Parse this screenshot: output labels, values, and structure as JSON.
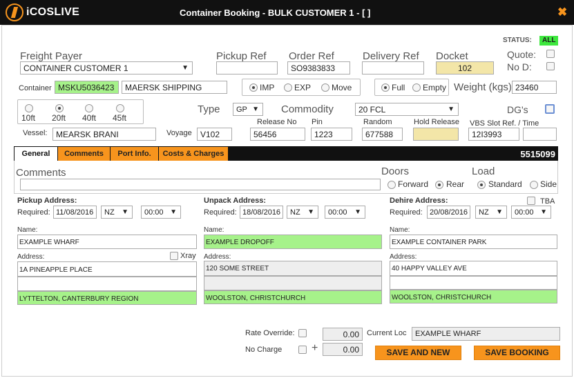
{
  "window": {
    "logo_text": "iCOSLIVE",
    "title": "Container Booking - BULK CUSTOMER 1  -  [ ]",
    "close_glyph": "✖"
  },
  "status": {
    "label": "STATUS:",
    "value": "ALL"
  },
  "freight_payer": {
    "label": "Freight Payer",
    "value": "CONTAINER CUSTOMER 1"
  },
  "pickup_ref": {
    "label": "Pickup Ref",
    "value": ""
  },
  "order_ref": {
    "label": "Order Ref",
    "value": "SO9383833"
  },
  "delivery_ref": {
    "label": "Delivery Ref",
    "value": ""
  },
  "docket": {
    "label": "Docket",
    "value": "102"
  },
  "quote": {
    "label": "Quote:"
  },
  "nod": {
    "label": "No D:"
  },
  "container": {
    "label": "Container",
    "number": "MSKU5036423",
    "shipping": "MAERSK SHIPPING"
  },
  "direction": {
    "options": [
      "IMP",
      "EXP",
      "Move"
    ],
    "selected": "IMP"
  },
  "fill": {
    "options": [
      "Full",
      "Empty"
    ],
    "selected": "Full"
  },
  "weight": {
    "label": "Weight (kgs)",
    "value": "23460"
  },
  "size": {
    "options": [
      "10ft",
      "20ft",
      "40ft",
      "45ft"
    ],
    "selected": "20ft"
  },
  "type": {
    "label": "Type",
    "value": "GP"
  },
  "commodity": {
    "label": "Commodity",
    "value": "20 FCL"
  },
  "dgs": {
    "label": "DG's"
  },
  "vessel": {
    "label": "Vessel:",
    "value": "MEARSK BRANI"
  },
  "voyage": {
    "label": "Voyage",
    "value": "V102"
  },
  "release_no": {
    "label": "Release No",
    "value": "56456"
  },
  "pin": {
    "label": "Pin",
    "value": "1223"
  },
  "random": {
    "label": "Random",
    "value": "677588"
  },
  "hold_release": {
    "label": "Hold Release",
    "value": ""
  },
  "vbs": {
    "label": "VBS Slot Ref. / Time",
    "value": "12I3993",
    "time": ""
  },
  "tabs": {
    "general": "General",
    "comments": "Comments",
    "port_info": "Port Info.",
    "costs": "Costs & Charges",
    "booking_number": "5515099"
  },
  "comments": {
    "label": "Comments",
    "value": ""
  },
  "doors": {
    "label": "Doors",
    "options": [
      "Forward",
      "Rear"
    ],
    "selected": "Rear"
  },
  "load": {
    "label": "Load",
    "options": [
      "Standard",
      "Side"
    ],
    "selected": "Standard"
  },
  "pickup": {
    "title": "Pickup Address:",
    "required_label": "Required:",
    "date": "11/08/2016",
    "tz": "NZ",
    "time": "00:00",
    "name_label": "Name:",
    "name": "EXAMPLE WHARF",
    "address_label": "Address:",
    "xray_label": "Xray",
    "line1": "1A PINEAPPLE PLACE",
    "line2": "",
    "line3": "LYTTELTON,    CANTERBURY REGION"
  },
  "unpack": {
    "title": "Unpack Address:",
    "required_label": "Required:",
    "date": "18/08/2016",
    "tz": "NZ",
    "time": "00:00",
    "name_label": "Name:",
    "name": "EXAMPLE DROPOFF",
    "address_label": "Address:",
    "line1": "120 SOME STREET",
    "line2": "",
    "line3": "WOOLSTON, CHRISTCHURCH"
  },
  "dehire": {
    "title": "Dehire Address:",
    "required_label": "Required:",
    "date": "20/08/2016",
    "tz": "NZ",
    "time": "00:00",
    "tba_label": "TBA",
    "name_label": "Name:",
    "name": "EXAMPLE CONTAINER PARK",
    "address_label": "Address:",
    "line1": "40 HAPPY VALLEY AVE",
    "line2": "",
    "line3": "WOOLSTON,     CHRISTCHURCH"
  },
  "rate_override": {
    "label": "Rate Override:",
    "value": "0.00"
  },
  "no_charge": {
    "label": "No Charge",
    "plus": "+",
    "value": "0.00"
  },
  "current_loc": {
    "label": "Current Loc",
    "value": "EXAMPLE WHARF"
  },
  "buttons": {
    "save_and_new": "SAVE AND NEW",
    "save_booking": "SAVE BOOKING"
  },
  "colors": {
    "accent": "#f7941d",
    "green": "#a6f28a",
    "status_green": "#3ee83e",
    "titlebar": "#111111"
  }
}
